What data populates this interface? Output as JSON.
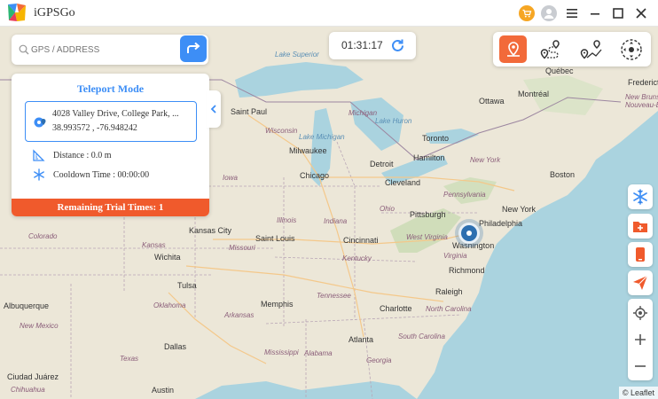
{
  "app": {
    "title": "iGPSGo"
  },
  "search": {
    "placeholder": "GPS / ADDRESS"
  },
  "timer": {
    "value": "01:31:17"
  },
  "panel": {
    "title": "Teleport Mode",
    "address_line1": "4028 Valley Drive, College Park, ...",
    "address_line2": "38.993572 , -76.948242",
    "distance": "Distance : 0.0 m",
    "cooldown": "Cooldown Time : 00:00:00",
    "trial": "Remaining Trial Times: 1"
  },
  "map": {
    "attribution": "© Leaflet",
    "cities": [
      "Québec",
      "Fredericton",
      "Ottawa",
      "Montréal",
      "Saint Paul",
      "Milwaukee",
      "Toronto",
      "Detroit",
      "Hamilton",
      "Boston",
      "Chicago",
      "Cleveland",
      "New York",
      "Pittsburgh",
      "Philadelphia",
      "Kansas City",
      "Saint Louis",
      "Cincinnati",
      "Washington",
      "Wichita",
      "Richmond",
      "Tulsa",
      "Raleigh",
      "Memphis",
      "Albuquerque",
      "Charlotte",
      "Atlanta",
      "Dallas",
      "Ciudad Juárez",
      "Austin"
    ],
    "states": [
      "New Brunswick",
      "Nouveau-Brunswick",
      "Wisconsin",
      "Michigan",
      "Iowa",
      "Illinois",
      "Indiana",
      "Ohio",
      "Pennsylvania",
      "New York",
      "Colorado",
      "Kansas",
      "Missouri",
      "West Virginia",
      "Virginia",
      "Kentucky",
      "Tennessee",
      "North Carolina",
      "Oklahoma",
      "Arkansas",
      "New Mexico",
      "Mississippi",
      "Alabama",
      "South Carolina",
      "Georgia",
      "Texas",
      "Chihuahua"
    ],
    "waters": [
      "Lake Superior",
      "Lake Huron",
      "Lake Michigan"
    ]
  },
  "colors": {
    "accent": "#3d8ef6",
    "warning": "#f05a2c",
    "marker": "#2d6fb0"
  }
}
